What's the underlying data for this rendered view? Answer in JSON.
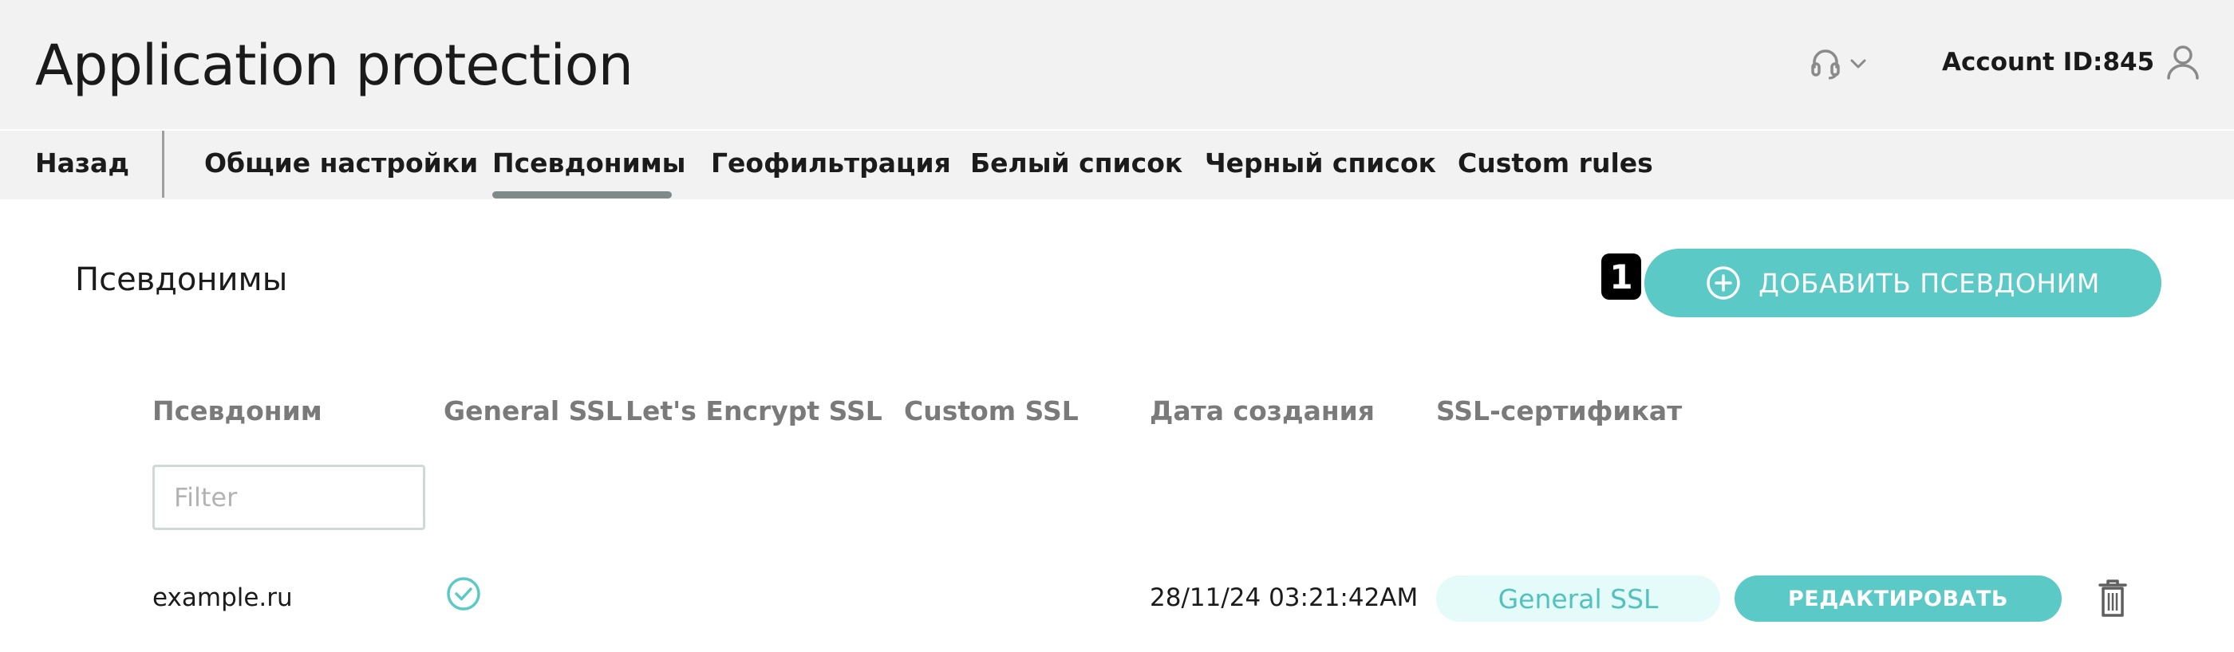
{
  "header": {
    "title": "Application protection",
    "support_icon": "headset-icon",
    "account_label": "Account ID:845",
    "account_icon": "user-icon"
  },
  "nav": {
    "back": "Назад",
    "tabs": [
      {
        "label": "Общие настройки"
      },
      {
        "label": "Псевдонимы",
        "active": true
      },
      {
        "label": "Геофильтрация"
      },
      {
        "label": "Белый список"
      },
      {
        "label": "Черный список"
      },
      {
        "label": "Custom rules"
      }
    ]
  },
  "section": {
    "title": "Псевдонимы",
    "badge": "1",
    "add_button_label": "ДОБАВИТЬ ПСЕВДОНИМ"
  },
  "table": {
    "columns": [
      "Псевдоним",
      "General SSL",
      "Let's Encrypt SSL",
      "Custom SSL",
      "Дата создания",
      "SSL-сертификат"
    ],
    "filter_placeholder": "Filter",
    "rows": [
      {
        "alias": "example.ru",
        "general_ssl": true,
        "created": "28/11/24 03:21:42AM",
        "certificate": "General SSL",
        "edit_label": "РЕДАКТИРОВАТЬ"
      }
    ]
  },
  "colors": {
    "accent": "#5bc9c5",
    "header_bg": "#f2f2f2",
    "pill_bg": "#e4fbf9"
  }
}
